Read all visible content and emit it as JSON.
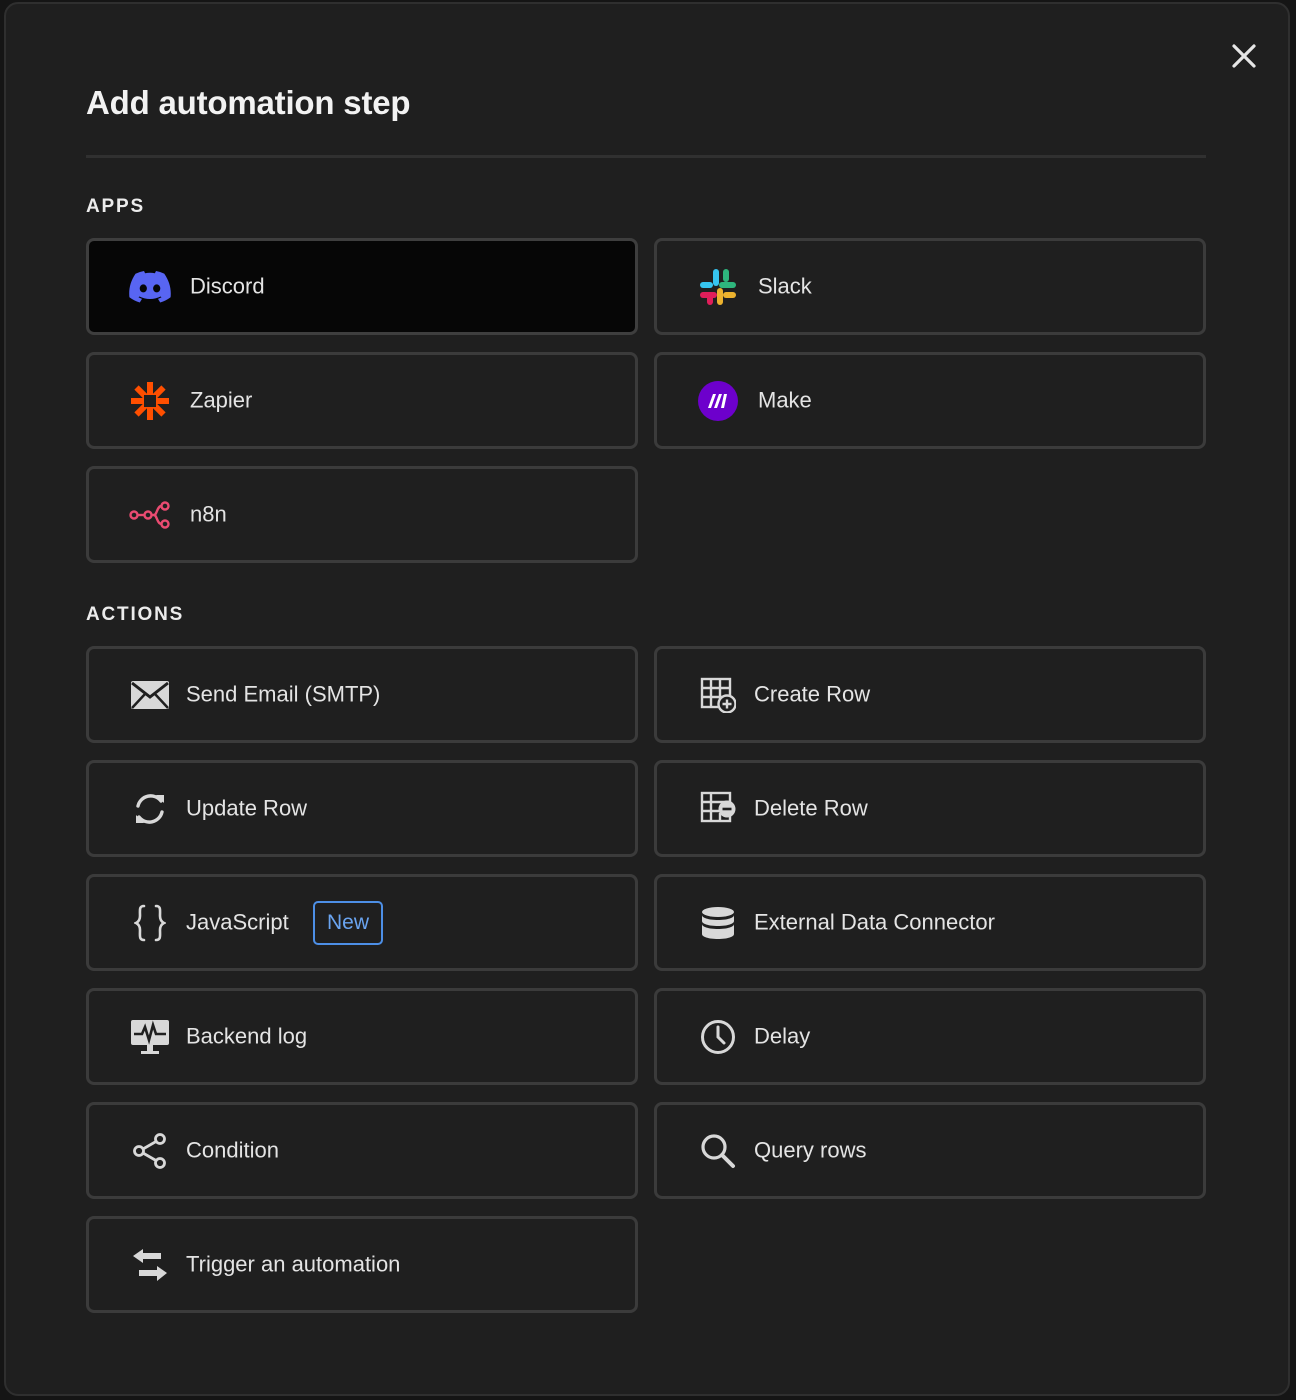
{
  "modal": {
    "title": "Add automation step",
    "close_icon": "close-icon"
  },
  "apps": {
    "heading": "APPS",
    "items": [
      {
        "label": "Discord",
        "icon": "discord-icon",
        "selected": true
      },
      {
        "label": "Slack",
        "icon": "slack-icon"
      },
      {
        "label": "Zapier",
        "icon": "zapier-icon"
      },
      {
        "label": "Make",
        "icon": "make-icon"
      },
      {
        "label": "n8n",
        "icon": "n8n-icon"
      }
    ]
  },
  "actions": {
    "heading": "ACTIONS",
    "items": [
      {
        "label": "Send Email (SMTP)",
        "icon": "envelope-icon"
      },
      {
        "label": "Create Row",
        "icon": "table-add-icon"
      },
      {
        "label": "Update Row",
        "icon": "refresh-icon"
      },
      {
        "label": "Delete Row",
        "icon": "table-remove-icon"
      },
      {
        "label": "JavaScript",
        "icon": "braces-icon",
        "badge": "New"
      },
      {
        "label": "External Data Connector",
        "icon": "database-icon"
      },
      {
        "label": "Backend log",
        "icon": "monitor-pulse-icon"
      },
      {
        "label": "Delay",
        "icon": "clock-icon"
      },
      {
        "label": "Condition",
        "icon": "branch-icon"
      },
      {
        "label": "Query rows",
        "icon": "search-icon"
      },
      {
        "label": "Trigger an automation",
        "icon": "swap-arrows-icon"
      }
    ]
  },
  "colors": {
    "background": "#1f1f1f",
    "card_border": "#3b3b3b",
    "selected_card": "#060606",
    "badge_blue": "#4d8fe6",
    "discord": "#5865f2",
    "zapier": "#ff4f00",
    "make": "#6d00cc",
    "n8n": "#ea4b71"
  }
}
